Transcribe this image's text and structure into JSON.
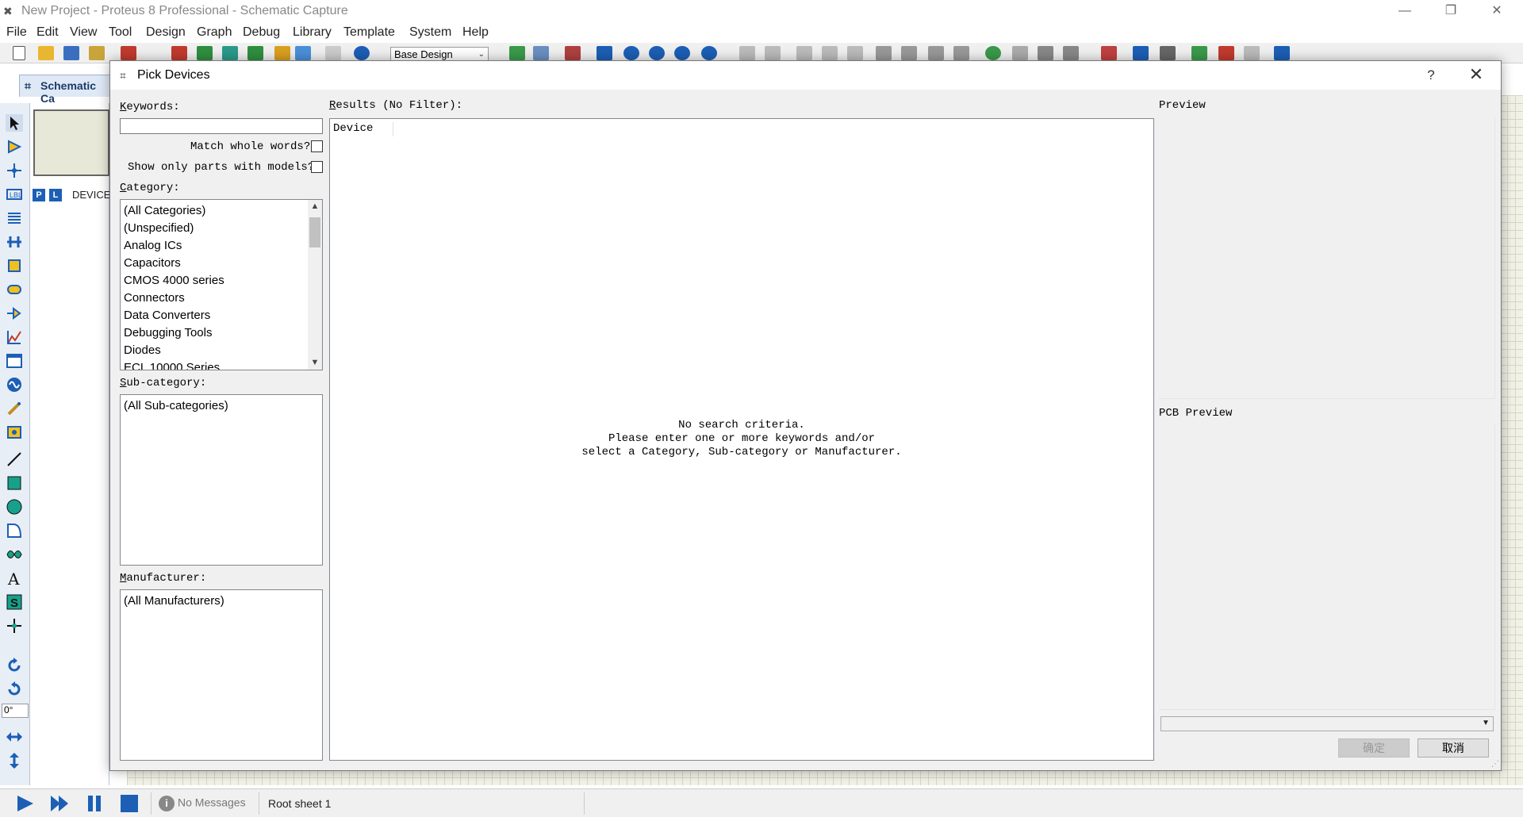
{
  "window": {
    "title": "New Project - Proteus 8 Professional - Schematic Capture",
    "minimize": "—",
    "restore": "❐",
    "close": "✕"
  },
  "menu": [
    "File",
    "Edit",
    "View",
    "Tool",
    "Design",
    "Graph",
    "Debug",
    "Library",
    "Template",
    "System",
    "Help"
  ],
  "toolbar": {
    "design_select": "Base Design"
  },
  "doc_tab": {
    "label": "Schematic Ca"
  },
  "left_panel": {
    "p_button": "P",
    "l_button": "L",
    "devices_label": "DEVICE",
    "rotation_value": "0°"
  },
  "dialog": {
    "title": "Pick Devices",
    "help": "?",
    "close": "✕",
    "keywords_label_u": "K",
    "keywords_label_rest": "eywords:",
    "keywords_value": "",
    "match_whole_words": "Match whole words?",
    "show_only_models": "Show only parts with models?",
    "category_label_u": "C",
    "category_label_rest": "ategory:",
    "categories": [
      "(All Categories)",
      "(Unspecified)",
      "Analog ICs",
      "Capacitors",
      "CMOS 4000 series",
      "Connectors",
      "Data Converters",
      "Debugging Tools",
      "Diodes",
      "ECL 10000 Series"
    ],
    "subcategory_label_u": "S",
    "subcategory_label_rest": "ub-category:",
    "subcategories": [
      "(All Sub-categories)"
    ],
    "manufacturer_label_u": "M",
    "manufacturer_label_rest": "anufacturer:",
    "manufacturers": [
      "(All Manufacturers)"
    ],
    "results_label_u": "R",
    "results_label_rest": "esults (No Filter):",
    "results_column": "Device",
    "results_message": [
      "No search criteria.",
      "Please enter one or more keywords and/or",
      "select a Category, Sub-category or Manufacturer."
    ],
    "preview_label": "Preview",
    "pcb_preview_label": "PCB Preview",
    "ok_button": "确定",
    "cancel_button": "取消"
  },
  "statusbar": {
    "messages": "No Messages",
    "sheet": "Root sheet 1"
  },
  "colors": {
    "accent_blue": "#1c5fb5",
    "canvas": "#f1f1e6"
  }
}
